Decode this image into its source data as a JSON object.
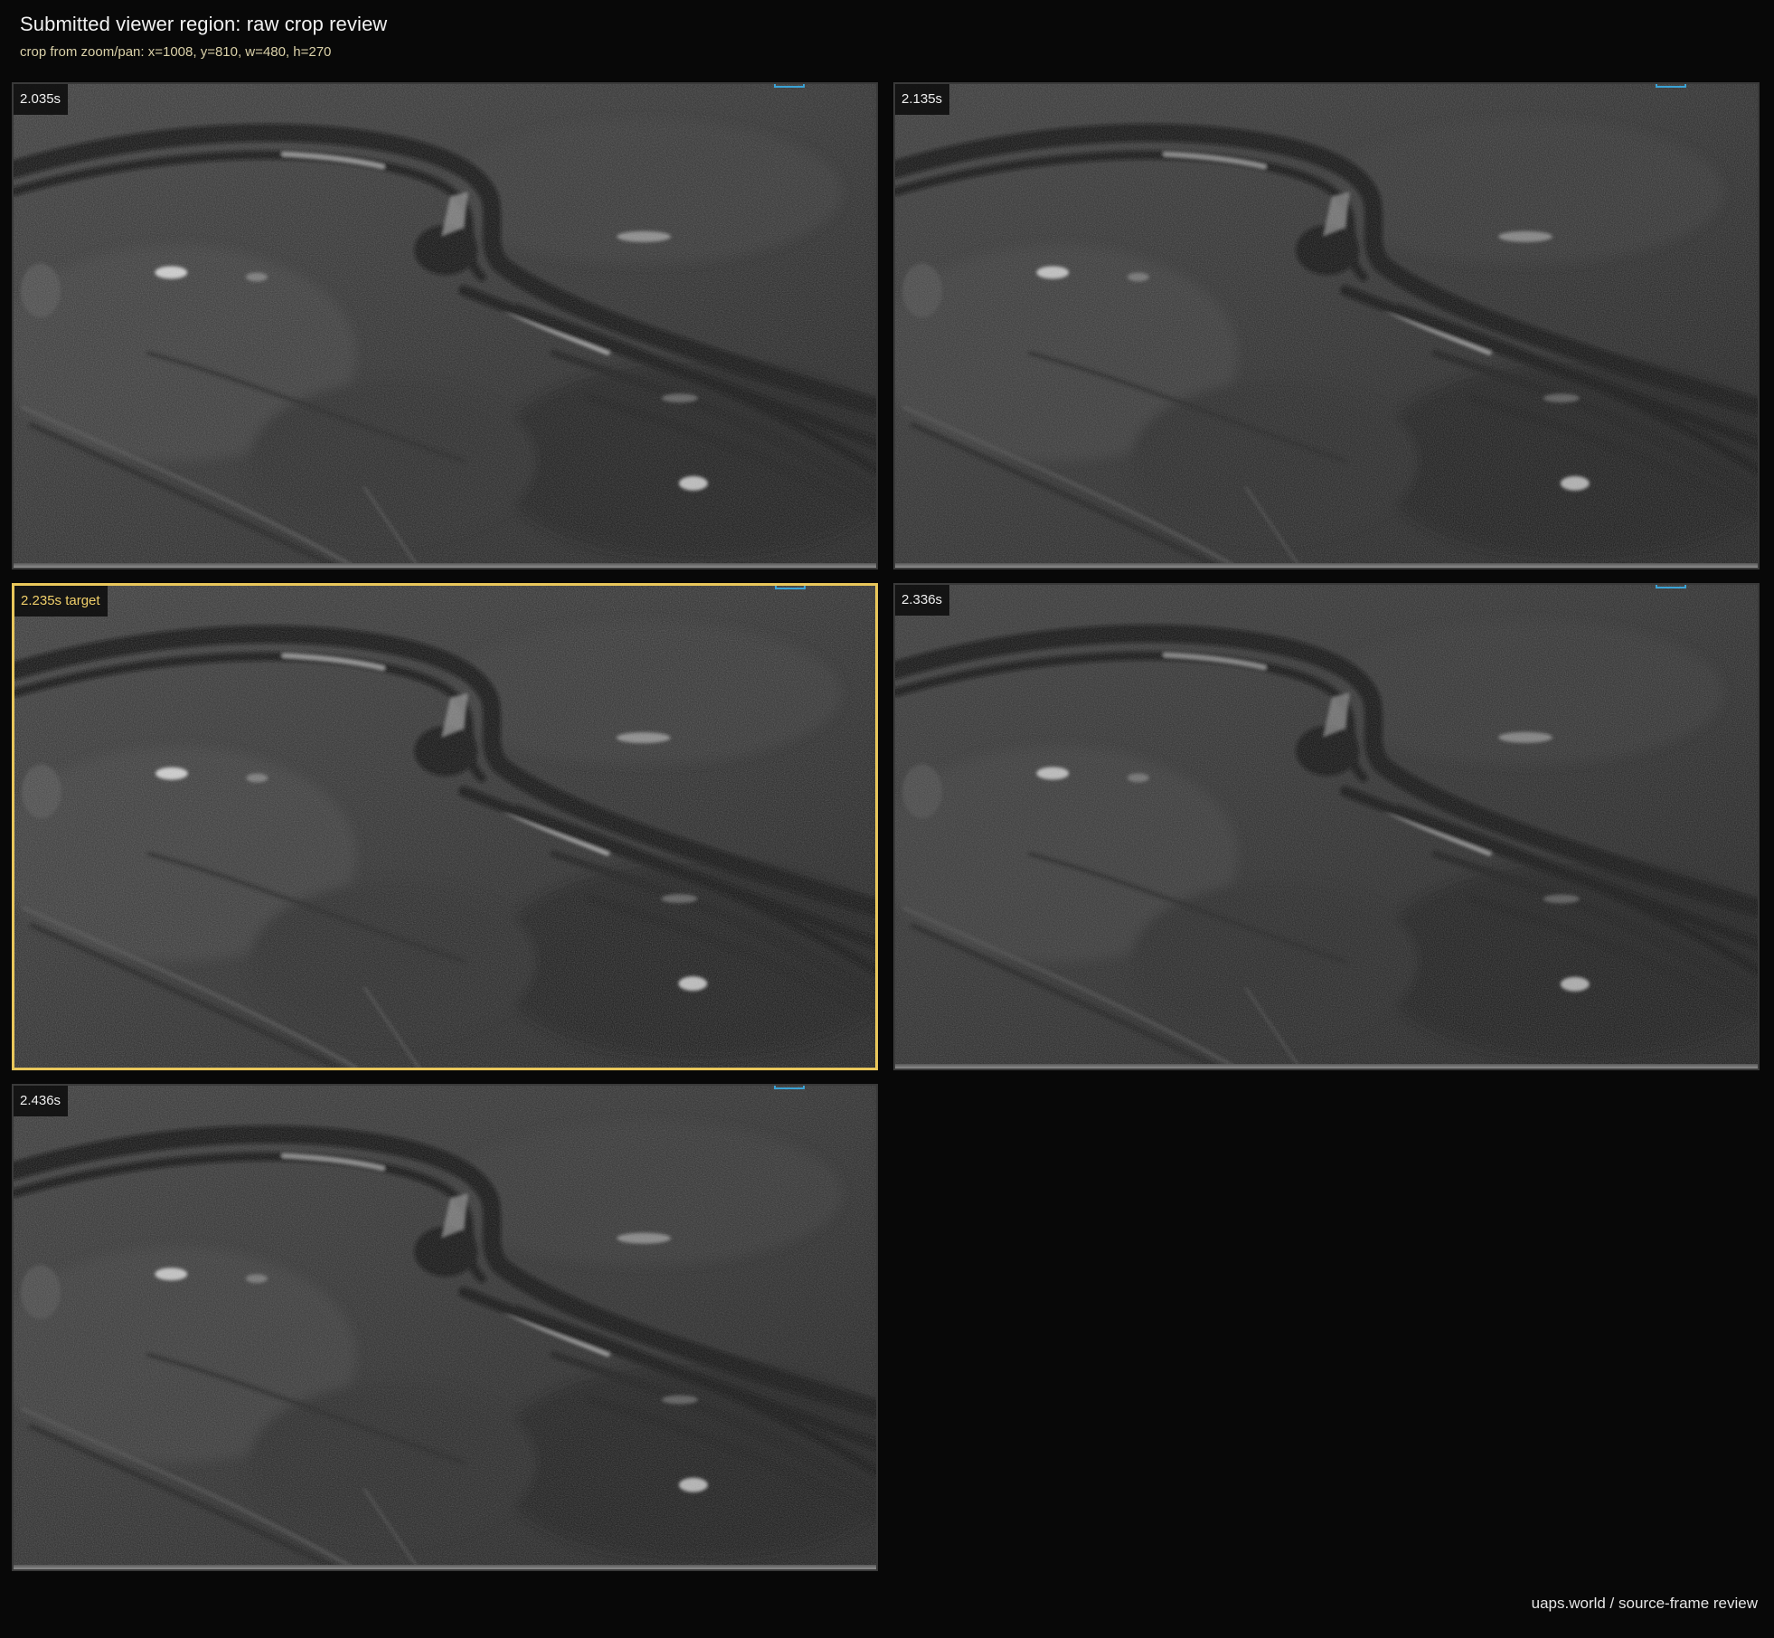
{
  "header": {
    "title": "Submitted viewer region: raw crop review",
    "subtitle": "crop from zoom/pan: x=1008, y=810, w=480, h=270"
  },
  "frames": [
    {
      "label": "2.035s",
      "is_target": false
    },
    {
      "label": "2.135s",
      "is_target": false
    },
    {
      "label": "2.235s target",
      "is_target": true
    },
    {
      "label": "2.336s",
      "is_target": false
    },
    {
      "label": "2.436s",
      "is_target": false
    }
  ],
  "footer": {
    "credit": "uaps.world / source-frame review"
  },
  "colors": {
    "background": "#080808",
    "target_border": "#e9c75b",
    "hud_marker": "#3ba3d6"
  }
}
